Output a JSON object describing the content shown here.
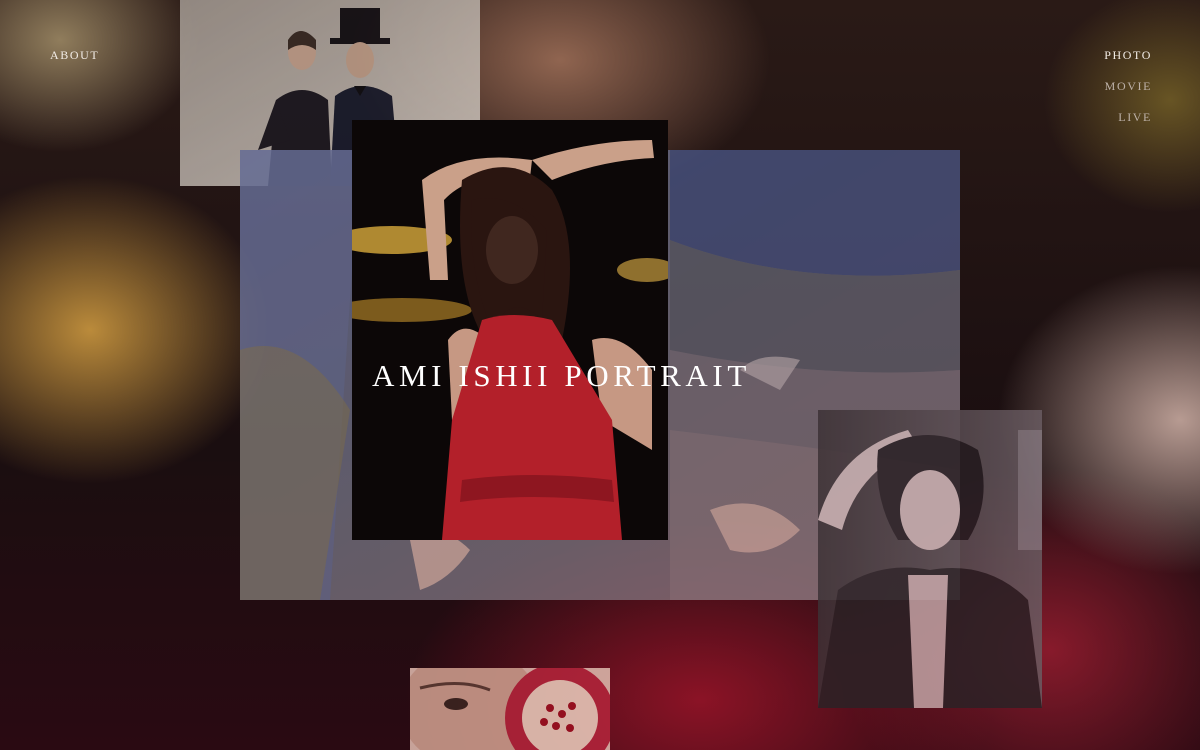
{
  "nav": {
    "about": "ABOUT",
    "items": [
      {
        "label": "PHOTO",
        "active": true
      },
      {
        "label": "MOVIE",
        "active": false
      },
      {
        "label": "LIVE",
        "active": false
      }
    ]
  },
  "hero": {
    "title": "AMI ISHII PORTRAIT"
  },
  "colors": {
    "dress_red": "#b3202a",
    "nav_text": "#f2ece6",
    "nav_dim": "#bdb1a8"
  }
}
